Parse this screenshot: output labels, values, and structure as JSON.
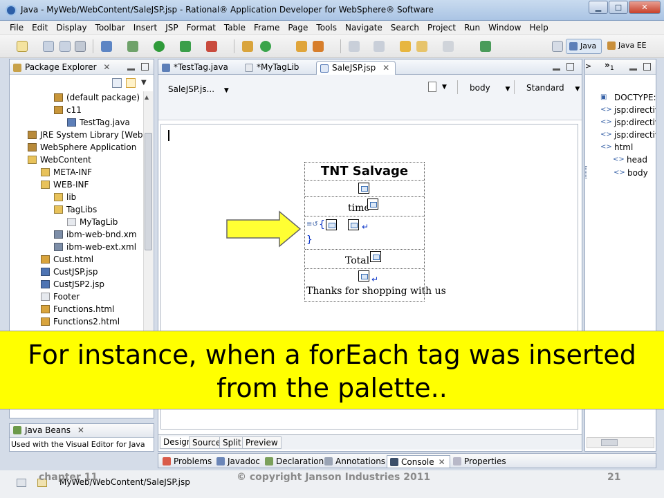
{
  "window": {
    "title": "Java - MyWeb/WebContent/SaleJSP.jsp - Rational® Application Developer for WebSphere® Software"
  },
  "menu": [
    "File",
    "Edit",
    "Display",
    "Toolbar",
    "Insert",
    "JSP",
    "Format",
    "Table",
    "Frame",
    "Page",
    "Tools",
    "Navigate",
    "Search",
    "Project",
    "Run",
    "Window",
    "Help"
  ],
  "perspectives": {
    "java": "Java",
    "javaee": "Java EE"
  },
  "package_explorer": {
    "title": "Package Explorer",
    "items": [
      {
        "label": "(default package)",
        "icon": "package-icon",
        "indent": 4
      },
      {
        "label": "c11",
        "icon": "package-icon",
        "indent": 4
      },
      {
        "label": "TestTag.java",
        "icon": "java-file-icon",
        "indent": 5
      },
      {
        "label": "JRE System Library [Web",
        "icon": "library-icon",
        "indent": 2
      },
      {
        "label": "WebSphere Application",
        "icon": "library-icon",
        "indent": 2
      },
      {
        "label": "WebContent",
        "icon": "folder-icon",
        "indent": 2
      },
      {
        "label": "META-INF",
        "icon": "folder-icon",
        "indent": 3
      },
      {
        "label": "WEB-INF",
        "icon": "folder-icon",
        "indent": 3
      },
      {
        "label": "lib",
        "icon": "folder-icon",
        "indent": 4
      },
      {
        "label": "TagLibs",
        "icon": "folder-icon",
        "indent": 4
      },
      {
        "label": "MyTagLib",
        "icon": "file-icon",
        "indent": 5
      },
      {
        "label": "ibm-web-bnd.xm",
        "icon": "xml-file-icon",
        "indent": 4
      },
      {
        "label": "ibm-web-ext.xml",
        "icon": "xml-file-icon",
        "indent": 4
      },
      {
        "label": "Cust.html",
        "icon": "html-file-icon",
        "indent": 3
      },
      {
        "label": "CustJSP.jsp",
        "icon": "jsp-file-icon",
        "indent": 3
      },
      {
        "label": "CustJSP2.jsp",
        "icon": "jsp-file-icon",
        "indent": 3
      },
      {
        "label": "Footer",
        "icon": "file-icon",
        "indent": 3
      },
      {
        "label": "Functions.html",
        "icon": "html-file-icon",
        "indent": 3
      },
      {
        "label": "Functions2.html",
        "icon": "html-file-icon",
        "indent": 3
      }
    ]
  },
  "editor": {
    "tabs": [
      {
        "label": "*TestTag.java",
        "active": false
      },
      {
        "label": "*MyTagLib",
        "active": false
      },
      {
        "label": "SaleJSP.jsp",
        "active": true
      }
    ],
    "file_selector": "SaleJSP.js...",
    "element_selector": "body",
    "mode_selector": "Standard",
    "design": {
      "heading": "TNT Salvage",
      "time_label": "time",
      "foreach_open": "{",
      "foreach_close": "}",
      "total_label": "Total",
      "thanks": "Thanks for shopping with us"
    },
    "bottom_tabs": [
      "Design",
      "Source",
      "Split",
      "Preview"
    ]
  },
  "outline": {
    "header_label": "1",
    "items": [
      {
        "label": "DOCTYPE:I",
        "icon": "doctype-icon",
        "indent": 0
      },
      {
        "label": "jsp:directiv",
        "icon": "tag-icon",
        "indent": 0
      },
      {
        "label": "jsp:directiv",
        "icon": "tag-icon",
        "indent": 0
      },
      {
        "label": "jsp:directiv",
        "icon": "tag-icon",
        "indent": 0
      },
      {
        "label": "html",
        "icon": "tag-icon",
        "indent": 0
      },
      {
        "label": "head",
        "icon": "tag-icon",
        "indent": 1
      },
      {
        "label": "body",
        "icon": "tag-icon",
        "indent": 1
      }
    ]
  },
  "java_beans": {
    "title": "Java Beans",
    "text": "Used with the Visual Editor for Java"
  },
  "console_tabs": [
    "Problems",
    "Javadoc",
    "Declaration",
    "Annotations",
    "Console",
    "Properties"
  ],
  "status": {
    "path": "MyWeb/WebContent/SaleJSP.jsp"
  },
  "footer": {
    "left": "chapter 11",
    "center": "© copyright Janson Industries 2011",
    "right": "21"
  },
  "caption": {
    "line1": "For instance, when a forEach tag was inserted",
    "line2": "from the palette.."
  },
  "colors": {
    "caption_bg": "#ffff00",
    "arrow_fill": "#ffff33",
    "title_bar": "#aac4e4"
  }
}
